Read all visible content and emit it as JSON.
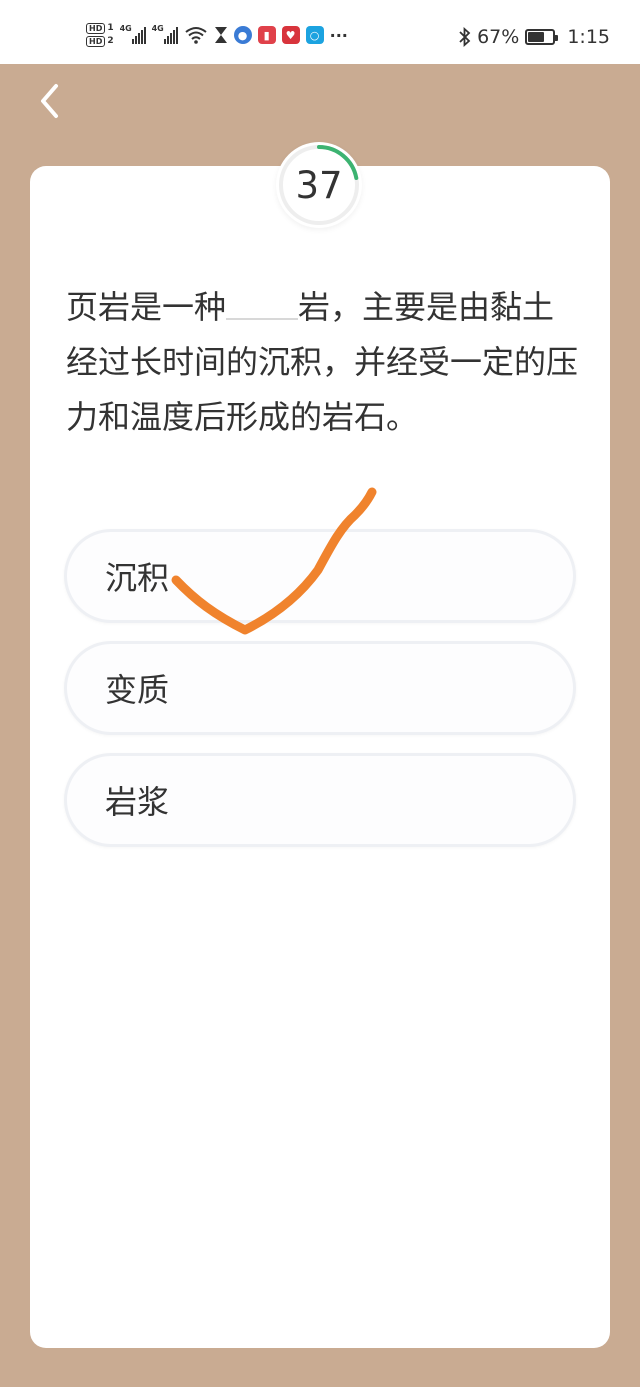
{
  "status_bar": {
    "hd1": "HD",
    "hd1_sub": "1",
    "hd2": "HD",
    "hd2_sub": "2",
    "network1": "4G",
    "network2": "4G",
    "more": "···",
    "battery_percent": "67%",
    "time": "1:15",
    "app_icon_colors": [
      "#3a7bd5",
      "#e0414a",
      "#d8343c",
      "#1ca3e0"
    ]
  },
  "quiz": {
    "timer": "37",
    "timer_progress_color": "#3cb371",
    "question_part1": "页岩是一种",
    "question_part2": "岩，主要是由黏土经过长时间的沉积，并经受一定的压力和温度后形成的岩石。",
    "options": [
      {
        "label": "沉积"
      },
      {
        "label": "变质"
      },
      {
        "label": "岩浆"
      }
    ],
    "annotation_color": "#f0832d"
  }
}
